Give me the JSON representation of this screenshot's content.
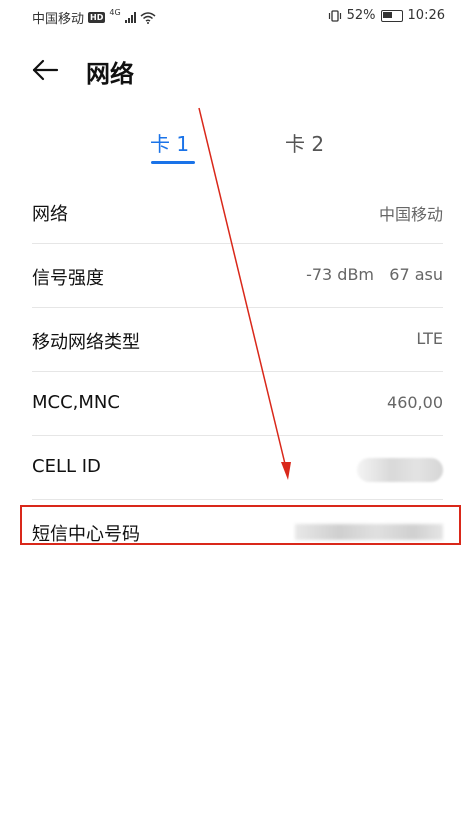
{
  "status_bar": {
    "carrier": "中国移动",
    "hd_badge": "HD",
    "network_gen": "4G",
    "battery_percent": "52%",
    "time": "10:26",
    "icons": [
      "hd-icon",
      "signal-icon",
      "wifi-icon",
      "vibrate-icon",
      "battery-icon"
    ]
  },
  "header": {
    "back_icon": "back-arrow-icon",
    "title": "网络"
  },
  "tabs": [
    {
      "label": "卡 1",
      "active": true
    },
    {
      "label": "卡 2",
      "active": false
    }
  ],
  "rows": [
    {
      "label": "网络",
      "value": "中国移动"
    },
    {
      "label": "信号强度",
      "value": "-73 dBm   67 asu"
    },
    {
      "label": "移动网络类型",
      "value": "LTE"
    },
    {
      "label": "MCC,MNC",
      "value": "460,00"
    },
    {
      "label": "CELL ID",
      "value_blurred": true
    },
    {
      "label": "短信中心号码",
      "value_blurred": true
    }
  ],
  "annotation": {
    "color": "#d9281a"
  },
  "colors": {
    "accent": "#1a73e8",
    "annotation_red": "#d9281a"
  }
}
